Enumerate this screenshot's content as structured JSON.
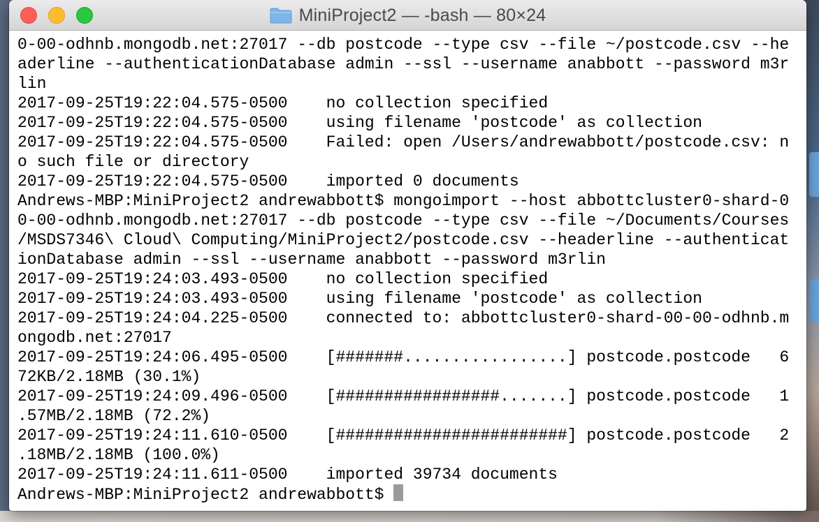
{
  "window": {
    "title": "MiniProject2 — -bash — 80×24"
  },
  "terminal": {
    "lines": [
      "0-00-odhnb.mongodb.net:27017 --db postcode --type csv --file ~/postcode.csv --he",
      "aderline --authenticationDatabase admin --ssl --username anabbott --password m3r",
      "lin",
      "2017-09-25T19:22:04.575-0500    no collection specified",
      "2017-09-25T19:22:04.575-0500    using filename 'postcode' as collection",
      "2017-09-25T19:22:04.575-0500    Failed: open /Users/andrewabbott/postcode.csv: n",
      "o such file or directory",
      "2017-09-25T19:22:04.575-0500    imported 0 documents",
      "Andrews-MBP:MiniProject2 andrewabbott$ mongoimport --host abbottcluster0-shard-0",
      "0-00-odhnb.mongodb.net:27017 --db postcode --type csv --file ~/Documents/Courses",
      "/MSDS7346\\ Cloud\\ Computing/MiniProject2/postcode.csv --headerline --authenticat",
      "ionDatabase admin --ssl --username anabbott --password m3rlin",
      "2017-09-25T19:24:03.493-0500    no collection specified",
      "2017-09-25T19:24:03.493-0500    using filename 'postcode' as collection",
      "2017-09-25T19:24:04.225-0500    connected to: abbottcluster0-shard-00-00-odhnb.m",
      "ongodb.net:27017",
      "2017-09-25T19:24:06.495-0500    [#######.................] postcode.postcode   6",
      "72KB/2.18MB (30.1%)",
      "2017-09-25T19:24:09.496-0500    [#################.......] postcode.postcode   1",
      ".57MB/2.18MB (72.2%)",
      "2017-09-25T19:24:11.610-0500    [########################] postcode.postcode   2",
      ".18MB/2.18MB (100.0%)",
      "2017-09-25T19:24:11.611-0500    imported 39734 documents"
    ],
    "prompt": "Andrews-MBP:MiniProject2 andrewabbott$ "
  }
}
